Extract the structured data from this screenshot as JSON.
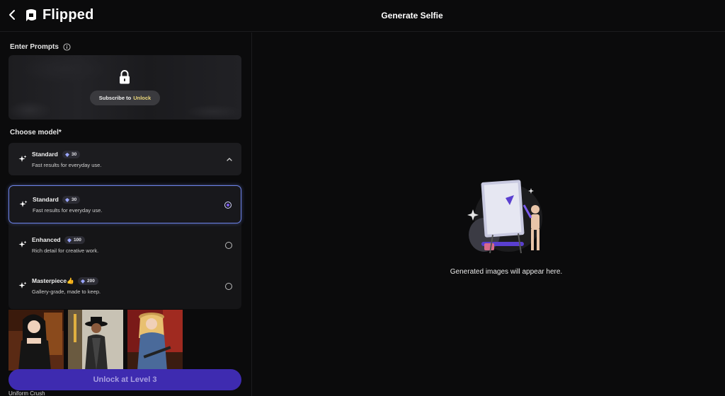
{
  "header": {
    "back_icon": "chevron-left-icon",
    "logo_icon": "flipped-logo-icon",
    "brand": "Flipped",
    "title": "Generate Selfie"
  },
  "prompts": {
    "label": "Enter Prompts",
    "info_icon": "info-icon",
    "lock_icon": "lock-icon",
    "subscribe_prefix": "Subscribe to",
    "subscribe_highlight": "Unlock"
  },
  "model": {
    "label": "Choose model*",
    "selected": {
      "name": "Standard",
      "cost": "30",
      "desc": "Fast results for everyday use."
    },
    "options": [
      {
        "name": "Standard",
        "cost": "30",
        "desc": "Fast results for everyday use.",
        "selected": true
      },
      {
        "name": "Enhanced",
        "cost": "100",
        "desc": "Rich detail for creative work.",
        "selected": false
      },
      {
        "name": "Masterpiece👍",
        "cost": "200",
        "desc": "Gallery-grade, made to keep.",
        "selected": false
      }
    ]
  },
  "styles": {
    "unlock_button": "Unlock at Level 3",
    "style_label": "Uniform Crush"
  },
  "results": {
    "empty_text": "Generated images will appear here."
  },
  "colors": {
    "accent": "#7b5cf0",
    "unlock_button_bg": "#3e2bb0",
    "selected_border": "#6c82e8"
  }
}
